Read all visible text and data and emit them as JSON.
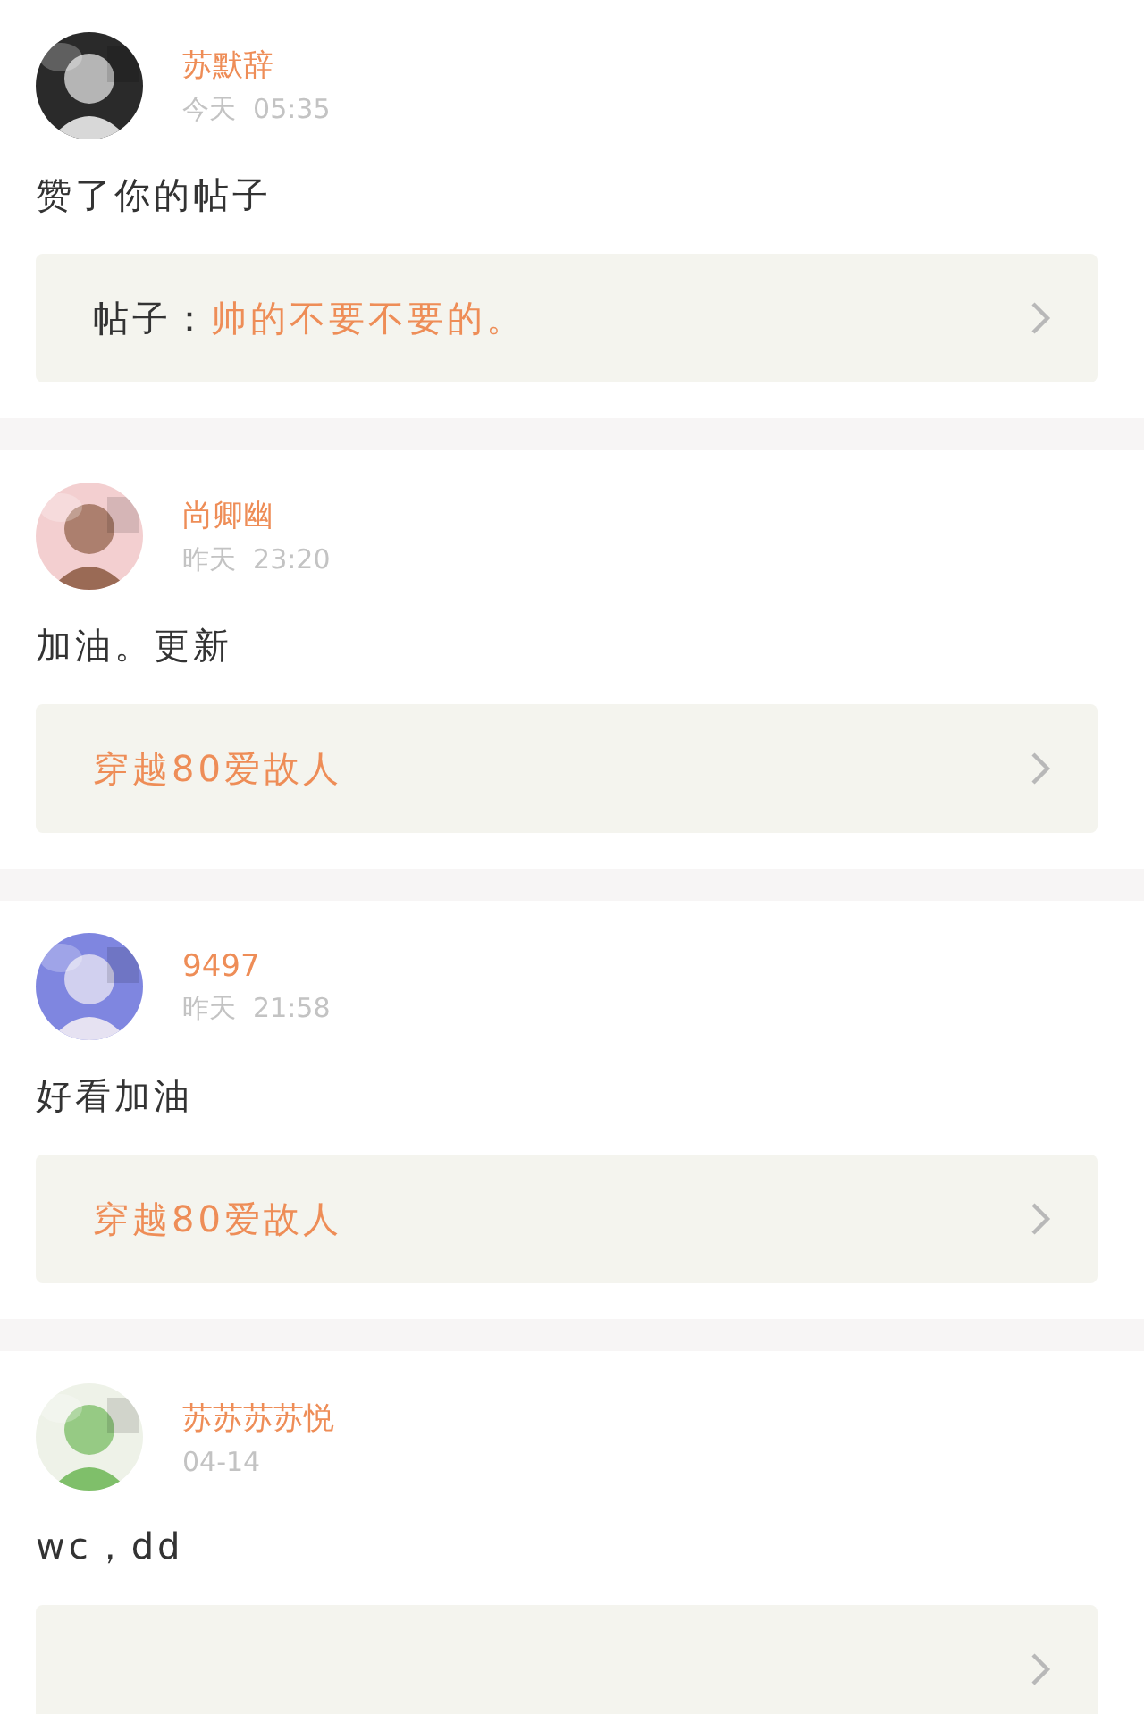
{
  "notifications": [
    {
      "user": "苏默辞",
      "time": "今天  05:35",
      "comment": "赞了你的帖子",
      "post": {
        "kind": "link",
        "label": "帖子：",
        "title": "帅的不要不要的。"
      }
    },
    {
      "user": "尚卿幽",
      "time": "昨天  23:20",
      "comment": "加油。更新",
      "post": {
        "kind": "link",
        "title": "穿越80爱故人"
      }
    },
    {
      "user": "9497",
      "time": "昨天  21:58",
      "comment": "好看加油",
      "post": {
        "kind": "link",
        "title": "穿越80爱故人"
      }
    },
    {
      "user": "苏苏苏苏悦",
      "time": "04-14",
      "comment": "wc，dd",
      "post": {
        "kind": "link"
      }
    }
  ]
}
